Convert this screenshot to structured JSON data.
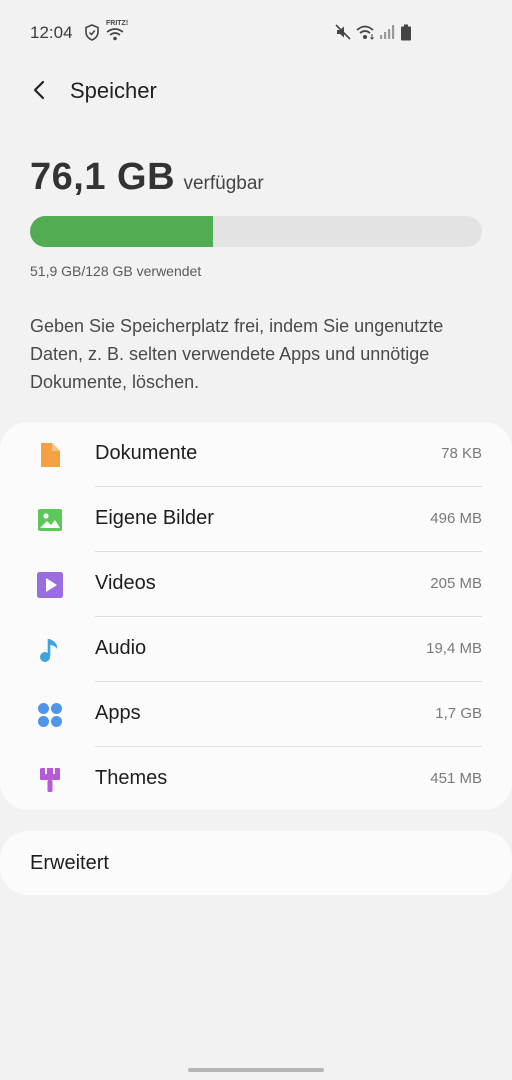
{
  "status_bar": {
    "time": "12:04",
    "wifi_label": "FRITZ!",
    "icons": [
      "shield-icon",
      "wifi-icon",
      "mute-icon",
      "wifi-icon",
      "signal-icon",
      "battery-icon"
    ]
  },
  "app_bar": {
    "title": "Speicher"
  },
  "storage": {
    "available_value": "76,1 GB",
    "available_label": "verfügbar",
    "used_text": "51,9 GB/128 GB verwendet",
    "used_fraction": 0.405,
    "bar_color": "#52ad52",
    "description": "Geben Sie Speicherplatz frei, indem Sie ungenutzte Daten, z. B. selten verwendete Apps und unnötige Dokumente, löschen."
  },
  "categories": [
    {
      "label": "Dokumente",
      "value": "78 KB",
      "icon": "document-icon",
      "color": "#f4a043"
    },
    {
      "label": "Eigene Bilder",
      "value": "496 MB",
      "icon": "image-icon",
      "color": "#5cc85a"
    },
    {
      "label": "Videos",
      "value": "205 MB",
      "icon": "video-icon",
      "color": "#9a6ee0"
    },
    {
      "label": "Audio",
      "value": "19,4 MB",
      "icon": "music-icon",
      "color": "#3fa3e0"
    },
    {
      "label": "Apps",
      "value": "1,7 GB",
      "icon": "apps-icon",
      "color": "#4f95e8"
    },
    {
      "label": "Themes",
      "value": "451 MB",
      "icon": "brush-icon",
      "color": "#b55ad8"
    }
  ],
  "advanced": {
    "label": "Erweitert"
  }
}
